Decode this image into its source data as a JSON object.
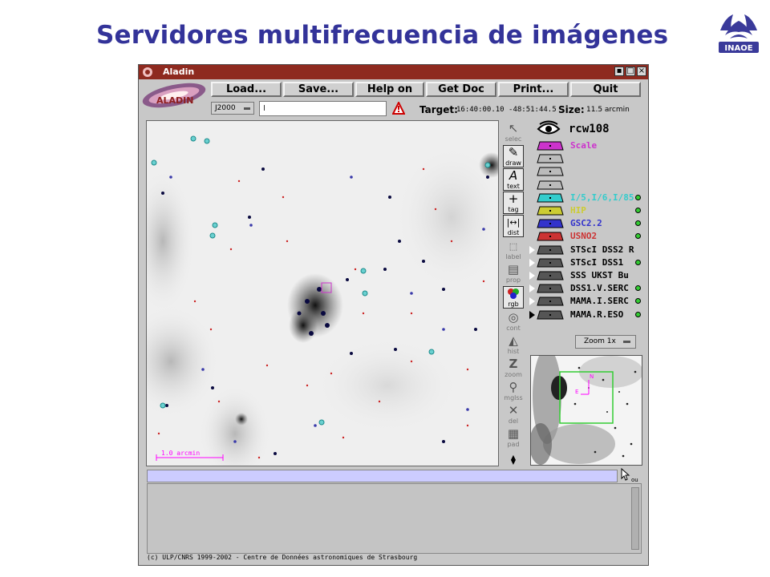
{
  "slide": {
    "title": "Servidores multifrecuencia de imágenes",
    "logo_text": "INAOE",
    "title_color": "#333399"
  },
  "window": {
    "title": "Aladin",
    "title_bar_color": "#8e2a1f",
    "controls": [
      "minimize",
      "maximize",
      "close"
    ]
  },
  "app_logo_text": "ALADIN",
  "toolbar": {
    "buttons": [
      "Load...",
      "Save...",
      "Help on",
      "Get Doc",
      "Print...",
      "Quit"
    ]
  },
  "frame_select": "J2000",
  "command_input": {
    "value": "I"
  },
  "target": {
    "label": "Target:",
    "value": "16:40:00.10 -48:51:44.5"
  },
  "size": {
    "label": "Size:",
    "value": "11.5 arcmin"
  },
  "image": {
    "scale_label": "1.0 arcmin"
  },
  "tools": [
    {
      "label": "selec",
      "icon": "arrow-icon",
      "active": false
    },
    {
      "label": "draw",
      "icon": "pencil-icon",
      "active": true
    },
    {
      "label": "text",
      "icon": "text-icon",
      "active": true
    },
    {
      "label": "tag",
      "icon": "cross-icon",
      "active": true
    },
    {
      "label": "dist",
      "icon": "distance-icon",
      "active": true
    },
    {
      "label": "label",
      "icon": "label-icon",
      "active": false
    },
    {
      "label": "prop",
      "icon": "properties-icon",
      "active": false
    },
    {
      "label": "rgb",
      "icon": "rgb-icon",
      "active": true
    },
    {
      "label": "cont",
      "icon": "contour-icon",
      "active": false
    },
    {
      "label": "hist",
      "icon": "histogram-icon",
      "active": false
    },
    {
      "label": "zoom",
      "icon": "zoom-icon",
      "active": false
    },
    {
      "label": "mglss",
      "icon": "magnifier-icon",
      "active": false
    },
    {
      "label": "del",
      "icon": "delete-icon",
      "active": false
    },
    {
      "label": "pad",
      "icon": "pad-icon",
      "active": false
    }
  ],
  "layers": {
    "target_name": "rcw108",
    "items": [
      {
        "name": "Scale",
        "color": "#cc33cc",
        "stack_color": "#cc33cc",
        "dot": false
      },
      {
        "name": "",
        "color": "#000000",
        "stack_color": "#bbbbbb",
        "dot": false
      },
      {
        "name": "",
        "color": "#000000",
        "stack_color": "#bbbbbb",
        "dot": false
      },
      {
        "name": "",
        "color": "#000000",
        "stack_color": "#bbbbbb",
        "dot": false
      },
      {
        "name": "I/5,I/6,I/85",
        "color": "#33cccc",
        "stack_color": "#33cccc",
        "dot": true
      },
      {
        "name": "HIP",
        "color": "#cccc33",
        "stack_color": "#cccc33",
        "dot": true
      },
      {
        "name": "GSC2.2",
        "color": "#3333cc",
        "stack_color": "#3333cc",
        "dot": true
      },
      {
        "name": "USNO2",
        "color": "#cc3333",
        "stack_color": "#cc3333",
        "dot": true
      },
      {
        "name": "STScI DSS2 R",
        "color": "#000000",
        "stack_color": "#555555",
        "dot": false
      },
      {
        "name": "STScI DSS1",
        "color": "#000000",
        "stack_color": "#555555",
        "dot": true
      },
      {
        "name": "SSS UKST Bu",
        "color": "#000000",
        "stack_color": "#555555",
        "dot": false
      },
      {
        "name": "DSS1.V.SERC",
        "color": "#000000",
        "stack_color": "#555555",
        "dot": true
      },
      {
        "name": "MAMA.I.SERC",
        "color": "#000000",
        "stack_color": "#555555",
        "dot": true
      },
      {
        "name": "MAMA.R.ESO",
        "color": "#000000",
        "stack_color": "#555555",
        "dot": true
      }
    ]
  },
  "zoom_select": "Zoom 1x",
  "thumbnail": {
    "north_label": "N",
    "east_label": "E"
  },
  "pointer_label": "ou",
  "copyright": "(c) ULP/CNRS 1999-2002 - Centre de Données astronomiques de Strasbourg"
}
